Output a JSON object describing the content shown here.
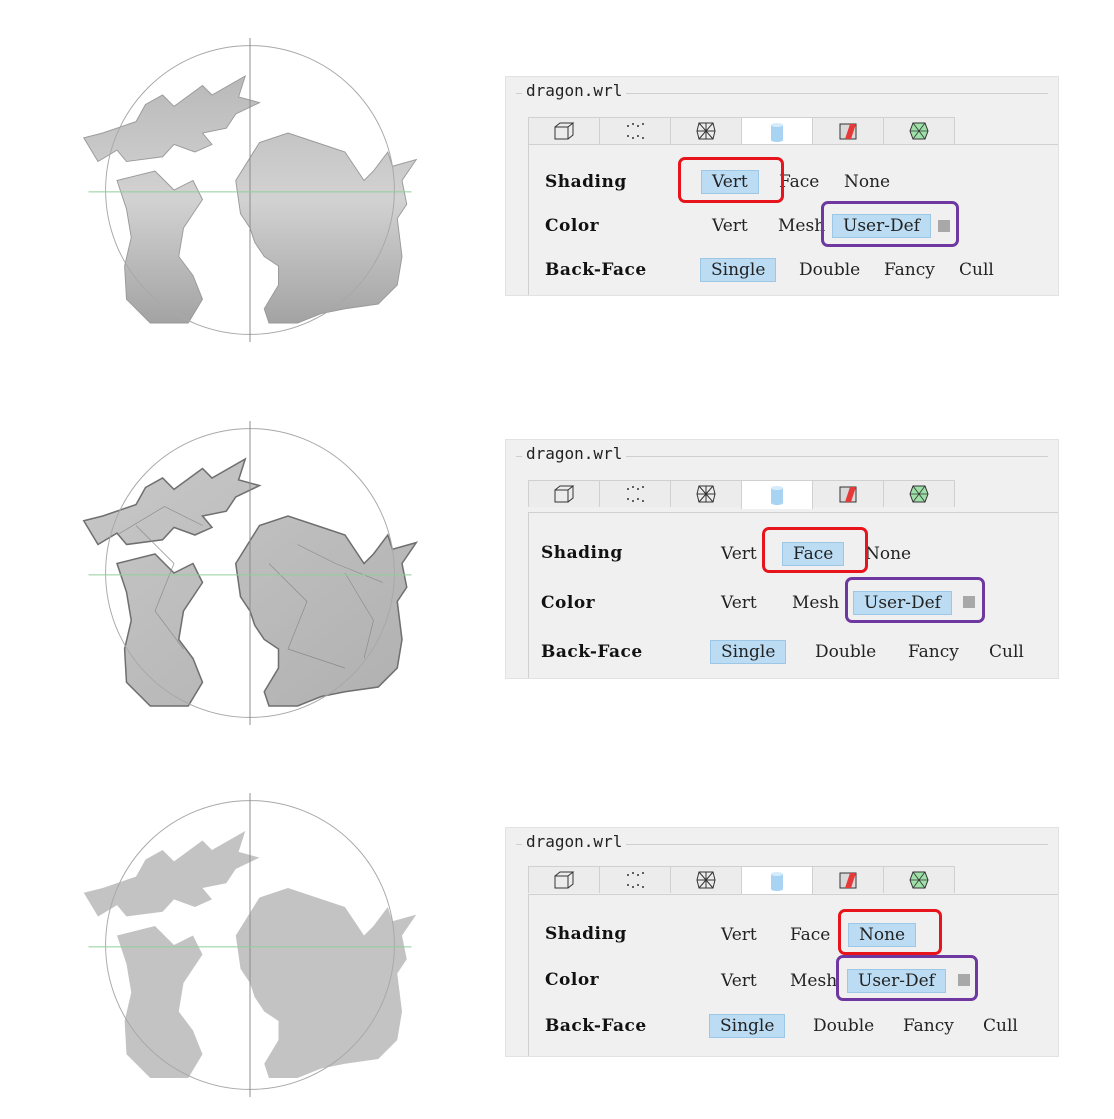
{
  "colors": {
    "accent_selected": "#bcdcf3",
    "highlight_red": "#e8141c",
    "highlight_purple": "#6e38a0",
    "panel_bg": "#f0f0f0"
  },
  "tab_icons": [
    "wireframe-box-icon",
    "points-icon",
    "mesh-wire-icon",
    "cylinder-icon",
    "red-texture-icon",
    "green-mesh-icon"
  ],
  "panels": [
    {
      "file": "dragon.wrl",
      "shading_label": "Shading",
      "color_label": "Color",
      "backface_label": "Back-Face",
      "shading_options": [
        "Vert",
        "Face",
        "None"
      ],
      "shading_selected": "Vert",
      "color_options": [
        "Vert",
        "Mesh",
        "User-Def"
      ],
      "color_selected": "User-Def",
      "backface_options": [
        "Single",
        "Double",
        "Fancy",
        "Cull"
      ],
      "backface_selected": "Single"
    },
    {
      "file": "dragon.wrl",
      "shading_label": "Shading",
      "color_label": "Color",
      "backface_label": "Back-Face",
      "shading_options": [
        "Vert",
        "Face",
        "None"
      ],
      "shading_selected": "Face",
      "color_options": [
        "Vert",
        "Mesh",
        "User-Def"
      ],
      "color_selected": "User-Def",
      "backface_options": [
        "Single",
        "Double",
        "Fancy",
        "Cull"
      ],
      "backface_selected": "Single"
    },
    {
      "file": "dragon.wrl",
      "shading_label": "Shading",
      "color_label": "Color",
      "backface_label": "Back-Face",
      "shading_options": [
        "Vert",
        "Face",
        "None"
      ],
      "shading_selected": "None",
      "color_options": [
        "Vert",
        "Mesh",
        "User-Def"
      ],
      "color_selected": "User-Def",
      "backface_options": [
        "Single",
        "Double",
        "Fancy",
        "Cull"
      ],
      "backface_selected": "Single"
    }
  ]
}
